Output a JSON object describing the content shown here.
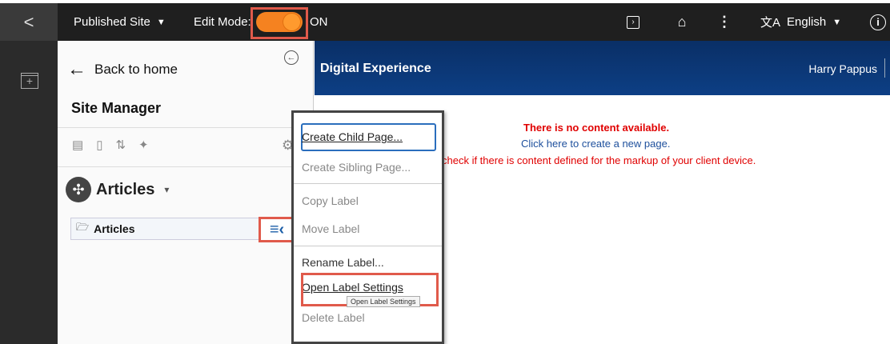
{
  "topbar": {
    "collapse_glyph": "<",
    "site_selector": "Published Site",
    "edit_mode_label": "Edit Mode:",
    "edit_mode_state": "ON",
    "language": "English",
    "accent_color": "#f58220"
  },
  "icons": {
    "preview": "preview-icon",
    "home": "home-icon",
    "more": "more-vertical-icon",
    "translate": "translate-icon",
    "info": "info-icon"
  },
  "panel": {
    "back_label": "Back to home",
    "title": "Site Manager",
    "nav_title": "Articles",
    "tree_item": "Articles"
  },
  "content": {
    "banner_title": "Digital Experience",
    "user_name": "Harry Pappus",
    "no_content": "There is no content available.",
    "create_link": "Click here to create a new page.",
    "markup_note": "check if there is content defined for the markup of your client device."
  },
  "context_menu": {
    "create_child": "Create Child Page...",
    "create_sibling": "Create Sibling Page...",
    "copy_label": "Copy Label",
    "move_label": "Move Label",
    "rename_label": "Rename Label...",
    "open_settings": "Open Label Settings",
    "tooltip": "Open Label Settings",
    "delete_label": "Delete Label"
  }
}
